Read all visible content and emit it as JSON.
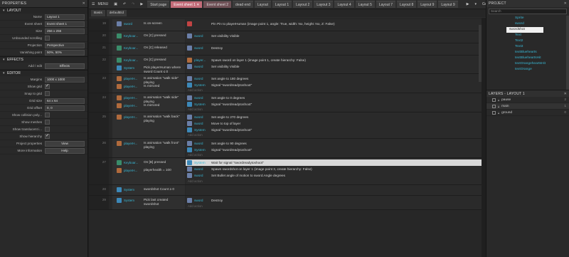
{
  "properties": {
    "title": "PROPERTIES",
    "layout_section": "LAYOUT",
    "layout_rows": [
      [
        "Name",
        "Layout 1"
      ],
      [
        "Event sheet",
        "Event sheet 1"
      ],
      [
        "Size",
        "256 x 256"
      ]
    ],
    "unbounded": "Unbounded scrolling",
    "projection": [
      "Projection",
      "Perspective"
    ],
    "vanishing": [
      "Vanishing point",
      "50%, 50%"
    ],
    "effects_section": "EFFECTS",
    "addedit": "Add / edit",
    "effects_btn": "Effects",
    "editor_section": "EDITOR",
    "margins": [
      "Margins",
      "1000 x 1000"
    ],
    "showgrid": "Show grid",
    "snap": "Snap to grid",
    "gridsize": [
      "Grid size",
      "64 x 64"
    ],
    "gridoffset": [
      "Grid offset",
      "0, 0"
    ],
    "showcoll": "Show collision poly...",
    "showmeshes": "Show meshes",
    "showtrans": "Show translucent i...",
    "showhier": "Show hierarchy",
    "projprops": "Project properties",
    "view_btn": "View",
    "moreinfo": "More information",
    "help_btn": "Help"
  },
  "menu": {
    "label": "MENU",
    "tabs": [
      "Start page",
      "Event sheet 1",
      "Event sheet 2",
      "dead end",
      "Layout",
      "Layout 1",
      "Layout 2",
      "Layout 3",
      "Layout 4",
      "Layout 5",
      "Layout 7",
      "Layout 8",
      "Layout 9",
      "Layout 9"
    ],
    "guest": "Guest",
    "sub": [
      "Basis",
      "defaultEd"
    ]
  },
  "events": [
    {
      "n": "19",
      "conds": [
        {
          "o": "sword",
          "t": "Is on-screen"
        }
      ],
      "acts": [
        {
          "o": "",
          "t": "Pin Pin to playerHuman (image point 1, angle: True, width: No, height: No, Z: False)"
        }
      ]
    },
    {
      "n": "20",
      "conds": [
        {
          "o": "Keyboar...",
          "t": "On [C] pressed"
        }
      ],
      "acts": [
        {
          "o": "sword",
          "t": "Set visibility Visible"
        }
      ]
    },
    {
      "n": "21",
      "conds": [
        {
          "o": "Keyboar...",
          "t": "On [C] released"
        }
      ],
      "acts": [
        {
          "o": "sword",
          "t": "Destroy"
        }
      ]
    },
    {
      "n": "22",
      "conds": [
        {
          "o": "Keyboar...",
          "t": "On [C] pressed"
        },
        {
          "o": "System",
          "t": "Pick playerHuman where sword Count ≤ 0"
        }
      ],
      "acts": [
        {
          "o": "player...",
          "t": "Spawn sword on layer 1 (image point 1, create hierarchy: False)"
        },
        {
          "o": "sword",
          "t": "Set visibility Visible"
        }
      ]
    },
    {
      "n": "23",
      "conds": [
        {
          "o": "playerH...",
          "t": "Is animation \"walk side\" playing"
        },
        {
          "o": "playerH...",
          "t": "Is mirrored"
        }
      ],
      "acts": [
        {
          "o": "sword",
          "t": "Set angle to 180 degrees"
        },
        {
          "o": "System",
          "t": "Signal \"swordreadytoshoot\""
        }
      ]
    },
    {
      "n": "24",
      "conds": [
        {
          "o": "playerH...",
          "t": "Is animation \"walk side\" playing"
        },
        {
          "o": "playerH...",
          "t": "Is mirrored"
        }
      ],
      "acts": [
        {
          "o": "sword",
          "t": "Set angle to 0 degrees"
        },
        {
          "o": "System",
          "t": "Signal \"swordreadytoshoot\""
        }
      ]
    },
    {
      "n": "25",
      "conds": [
        {
          "o": "playerH...",
          "t": "Is animation \"walk back\" playing"
        }
      ],
      "acts": [
        {
          "o": "sword",
          "t": "Set angle to 270 degrees"
        },
        {
          "o": "sword",
          "t": "Move to top of layer"
        },
        {
          "o": "System",
          "t": "Signal \"swordreadytoshoot\""
        }
      ]
    },
    {
      "n": "26",
      "conds": [
        {
          "o": "playerH...",
          "t": "Is animation \"walk front\" playing"
        }
      ],
      "acts": [
        {
          "o": "sword",
          "t": "Set angle to 90 degrees"
        },
        {
          "o": "System",
          "t": "Signal \"swordreadytoshoot\""
        }
      ]
    },
    {
      "n": "27",
      "conds": [
        {
          "o": "Keyboar...",
          "t": "On [B] pressed"
        },
        {
          "o": "playerH...",
          "t": "playerhealth = 100"
        }
      ],
      "acts": [
        {
          "o": "System",
          "t": "Wait for signal \"swordreadytoshoot\""
        },
        {
          "o": "sword",
          "t": "Spawn swordshot on layer 1 (image point 3, create hierarchy: False)"
        },
        {
          "o": "sword",
          "t": "Set Bullet angle of motion to sword.Angle degrees"
        }
      ]
    },
    {
      "n": "28",
      "conds": [
        {
          "o": "System",
          "t": "swordshot Count ≥ 0"
        }
      ],
      "acts": []
    },
    {
      "n": "29",
      "conds": [
        {
          "o": "System",
          "t": "Pick last created swordshot"
        }
      ],
      "acts": [
        {
          "o": "sword",
          "t": "Destroy"
        }
      ]
    }
  ],
  "add_action": "Add action",
  "project": {
    "title": "PROJECT",
    "search": "Search",
    "items": [
      "Sprite",
      "sword",
      "swordshot",
      "Text",
      "Text2",
      "Text3",
      "textBluehearts",
      "textBlueheartsHit",
      "textOrangeheartsHit",
      "textOrange"
    ]
  },
  "layers": {
    "title": "LAYERS - LAYOUT 1",
    "rows": [
      [
        "pause",
        "2"
      ],
      [
        "main",
        "1"
      ],
      [
        "ground",
        "0"
      ]
    ]
  }
}
